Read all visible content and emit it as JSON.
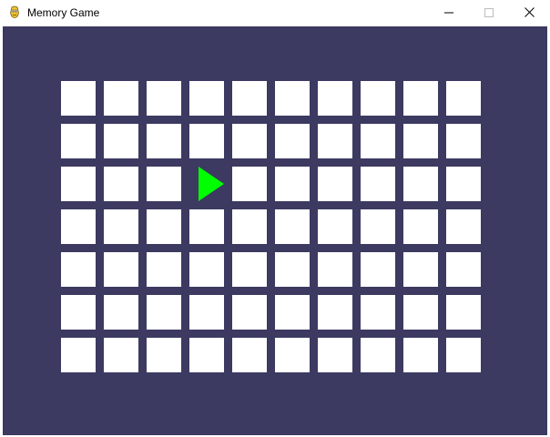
{
  "window": {
    "title": "Memory Game",
    "app_icon": "pygame-snake-icon",
    "controls": {
      "minimize_icon": "minimize-icon",
      "maximize_icon": "maximize-icon",
      "close_icon": "close-icon"
    }
  },
  "game": {
    "background_color": "#3c3a61",
    "tile_color": "#ffffff",
    "rows": 7,
    "columns": 10,
    "revealed_tiles": [
      {
        "row": 2,
        "column": 3,
        "shape": "triangle-right",
        "color": "#00ff00"
      }
    ]
  }
}
